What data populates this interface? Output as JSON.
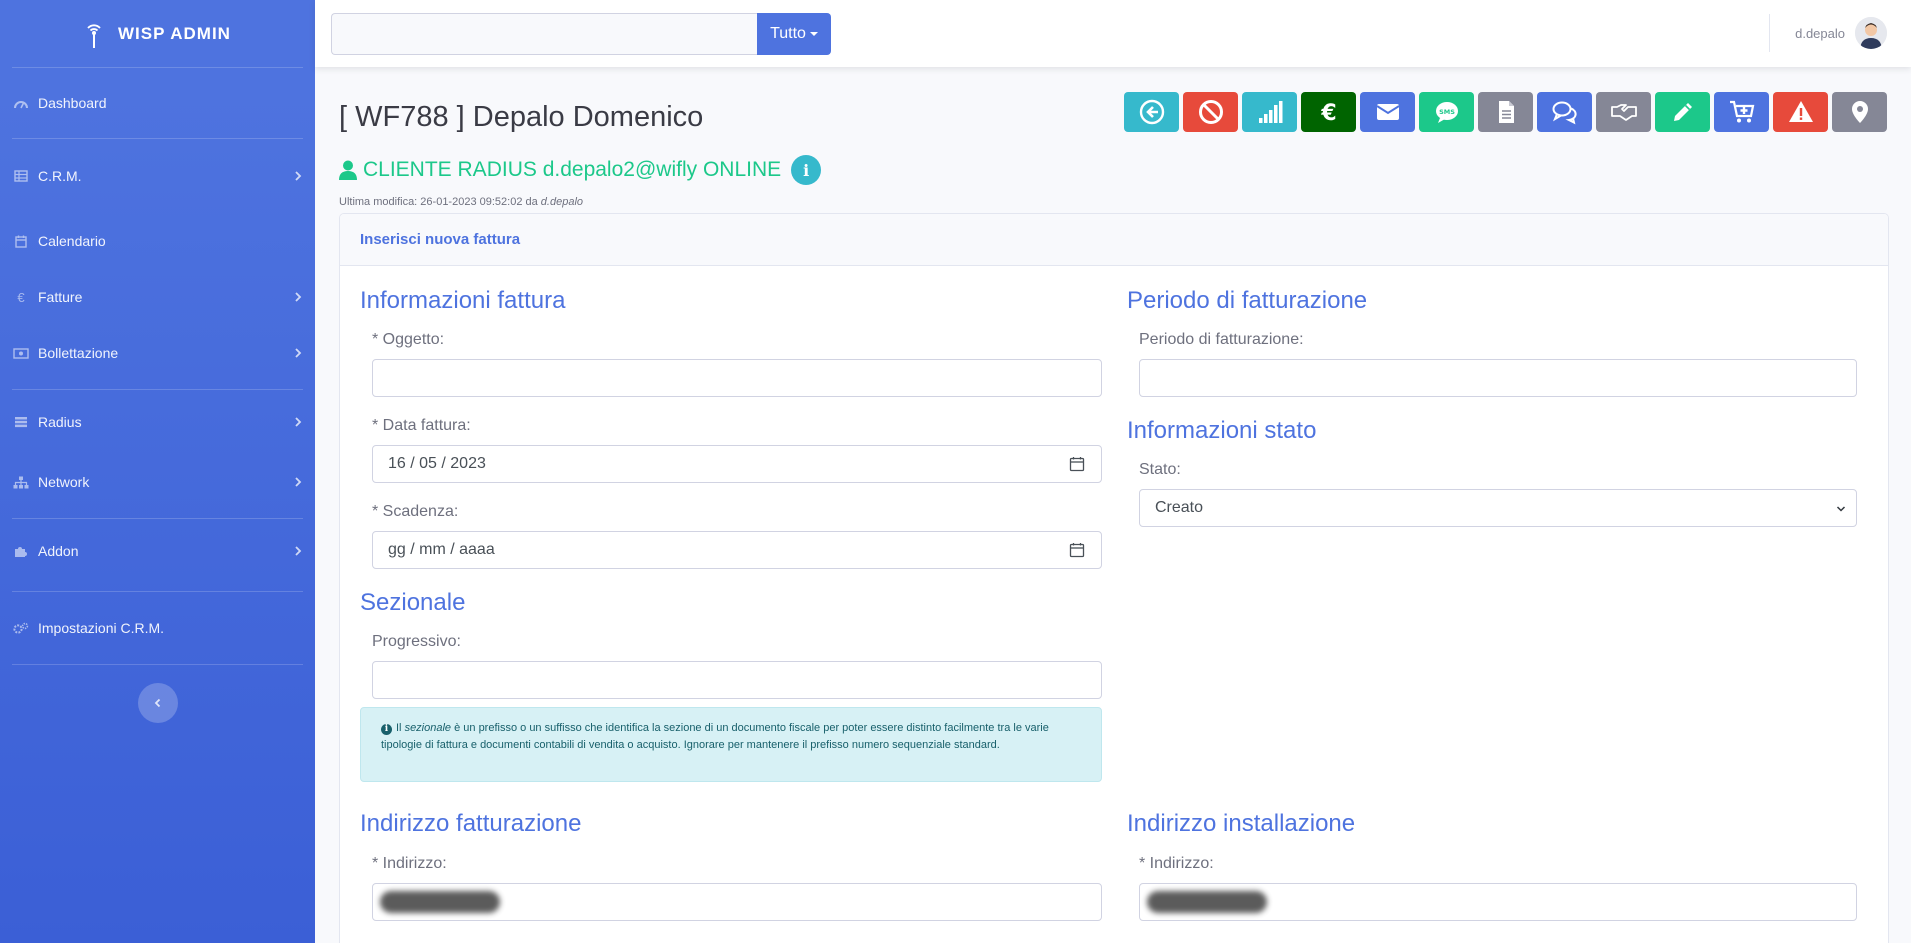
{
  "brand": {
    "name": "WISP ADMIN"
  },
  "sidebar": {
    "items": [
      {
        "label": "Dashboard",
        "icon": "dashboard-icon",
        "has_submenu": false
      },
      {
        "label": "C.R.M.",
        "icon": "table-icon",
        "has_submenu": true
      },
      {
        "label": "Calendario",
        "icon": "calendar-icon",
        "has_submenu": false
      },
      {
        "label": "Fatture",
        "icon": "euro-icon",
        "has_submenu": true
      },
      {
        "label": "Bollettazione",
        "icon": "money-bill-icon",
        "has_submenu": true
      },
      {
        "label": "Radius",
        "icon": "database-icon",
        "has_submenu": true
      },
      {
        "label": "Network",
        "icon": "sitemap-icon",
        "has_submenu": true
      },
      {
        "label": "Addon",
        "icon": "puzzle-icon",
        "has_submenu": true
      },
      {
        "label": "Impostazioni C.R.M.",
        "icon": "cogs-icon",
        "has_submenu": false
      }
    ]
  },
  "topbar": {
    "search_value": "",
    "search_scope": "Tutto",
    "username": "d.depalo"
  },
  "page": {
    "title": "[ WF788 ] Depalo Domenico",
    "subtitle": "CLIENTE RADIUS d.depalo2@wifly ONLINE",
    "last_modified_prefix": "Ultima modifica: 26-01-2023 09:52:02 da ",
    "last_modified_user": "d.depalo"
  },
  "actions": [
    {
      "name": "back-button",
      "icon": "arrow-left-circle-icon",
      "color": "#36b9cc"
    },
    {
      "name": "block-button",
      "icon": "ban-icon",
      "color": "#e74a3b"
    },
    {
      "name": "signal-button",
      "icon": "signal-icon",
      "color": "#36b9cc"
    },
    {
      "name": "euro-button",
      "icon": "euro-icon",
      "color": "#006400"
    },
    {
      "name": "email-button",
      "icon": "envelope-icon",
      "color": "#4e73df"
    },
    {
      "name": "sms-button",
      "icon": "sms-icon",
      "color": "#1cc88a"
    },
    {
      "name": "document-button",
      "icon": "file-icon",
      "color": "#858796"
    },
    {
      "name": "comments-button",
      "icon": "comments-icon",
      "color": "#4e73df"
    },
    {
      "name": "handshake-button",
      "icon": "handshake-icon",
      "color": "#858796"
    },
    {
      "name": "edit-button",
      "icon": "pencil-icon",
      "color": "#1cc88a"
    },
    {
      "name": "cart-button",
      "icon": "cart-plus-icon",
      "color": "#4e73df"
    },
    {
      "name": "warning-button",
      "icon": "warning-icon",
      "color": "#e74a3b"
    },
    {
      "name": "location-button",
      "icon": "map-marker-icon",
      "color": "#858796"
    }
  ],
  "form": {
    "header": "Inserisci nuova fattura",
    "info": {
      "title": "Informazioni fattura",
      "oggetto_label": "* Oggetto:",
      "oggetto_value": "",
      "data_label": "* Data fattura:",
      "data_value": "16 / 05 / 2023",
      "scadenza_label": "* Scadenza:",
      "scadenza_placeholder": "gg / mm / aaaa"
    },
    "periodo": {
      "title": "Periodo di fatturazione",
      "label": "Periodo di fatturazione:",
      "value": ""
    },
    "stato": {
      "title": "Informazioni stato",
      "label": "Stato:",
      "selected": "Creato"
    },
    "sezionale": {
      "title": "Sezionale",
      "label": "Progressivo:",
      "value": "",
      "help_pre": "Il ",
      "help_em": "sezionale",
      "help_post": " è un prefisso o un suffisso che identifica la sezione di un documento fiscale per poter essere distinto facilmente tra le varie tipologie di fattura e documenti contabili di vendita o acquisto. Ignorare per mantenere il prefisso numero sequenziale standard."
    },
    "fatturazione": {
      "title": "Indirizzo fatturazione",
      "label": "* Indirizzo:"
    },
    "installazione": {
      "title": "Indirizzo installazione",
      "label": "* Indirizzo:"
    }
  }
}
